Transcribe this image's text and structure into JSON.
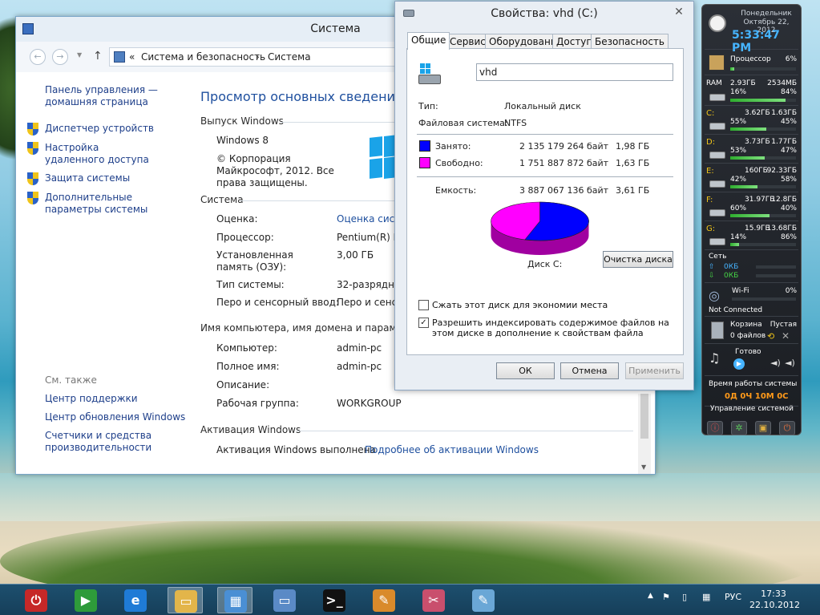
{
  "system_window": {
    "title": "Система",
    "address": {
      "prefix": "«",
      "crumbs": [
        "Система и безопасность",
        "Система"
      ],
      "separator": "›"
    },
    "nav": {
      "home_link": "Панель управления — домашняя страница",
      "items": [
        {
          "label": "Диспетчер устройств",
          "icon": "shield-icon"
        },
        {
          "label": "Настройка удаленного доступа",
          "icon": "shield-icon"
        },
        {
          "label": "Защита системы",
          "icon": "shield-icon"
        },
        {
          "label": "Дополнительные параметры системы",
          "icon": "shield-icon"
        }
      ],
      "see_also_title": "См. также",
      "see_also": [
        "Центр поддержки",
        "Центр обновления Windows",
        "Счетчики и средства производительности"
      ]
    },
    "heading": "Просмотр основных сведений о вашем компьютере",
    "edition": {
      "title": "Выпуск Windows",
      "name": "Windows 8",
      "copyright": "© Корпорация Майкрософт, 2012. Все права защищены."
    },
    "system": {
      "title": "Система",
      "rows": [
        {
          "label": "Оценка:",
          "value": "Оценка системы недоступна",
          "link": true
        },
        {
          "label": "Процессор:",
          "value": "Pentium(R) Dual-Core CPU"
        },
        {
          "label": "Установленная память (ОЗУ):",
          "value": "3,00 ГБ"
        },
        {
          "label": "Тип системы:",
          "value": "32-разрядная операционная система"
        },
        {
          "label": "Перо и сенсорный ввод:",
          "value": "Перо и сенсорный ввод недоступны"
        }
      ]
    },
    "computer": {
      "title": "Имя компьютера, имя домена и параметры рабочей группы",
      "rows": [
        {
          "label": "Компьютер:",
          "value": "admin-pc"
        },
        {
          "label": "Полное имя:",
          "value": "admin-pc"
        },
        {
          "label": "Описание:",
          "value": ""
        },
        {
          "label": "Рабочая группа:",
          "value": "WORKGROUP"
        }
      ]
    },
    "activation": {
      "title": "Активация Windows",
      "status": "Активация Windows выполнена",
      "link": "Подробнее об активации Windows"
    }
  },
  "properties_dialog": {
    "title": "Свойства: vhd (C:)",
    "close": "✕",
    "tabs": [
      "Общие",
      "Сервис",
      "Оборудование",
      "Доступ",
      "Безопасность"
    ],
    "active_tab": "Общие",
    "volume_name": "vhd",
    "type_label": "Тип:",
    "type_value": "Локальный диск",
    "fs_label": "Файловая система:",
    "fs_value": "NTFS",
    "used": {
      "label": "Занято:",
      "bytes": "2 135 179 264 байт",
      "size": "1,98 ГБ",
      "color": "#0000ff"
    },
    "free": {
      "label": "Свободно:",
      "bytes": "1 751 887 872 байт",
      "size": "1,63 ГБ",
      "color": "#ff00ff"
    },
    "capacity": {
      "label": "Емкость:",
      "bytes": "3 887 067 136 байт",
      "size": "3,61 ГБ"
    },
    "disk_label": "Диск C:",
    "cleanup_button": "Очистка диска",
    "compress_label": "Сжать этот диск для экономии места",
    "compress_checked": false,
    "index_label": "Разрешить индексировать содержимое файлов на этом диске в дополнение к свойствам файла",
    "index_checked": true,
    "ok": "ОК",
    "cancel": "Отмена",
    "apply": "Применить"
  },
  "gadget": {
    "day": "Понедельник",
    "date": "Октябрь 22, 2012",
    "time": "5:33:47 PM",
    "cpu": {
      "label": "Процессор",
      "percent": "6%",
      "level": 6
    },
    "ram": {
      "label": "RAM",
      "used": "2.93ГБ",
      "total": "2534МБ",
      "left_pct": "16%",
      "right_pct": "84%",
      "level": 84
    },
    "drives": [
      {
        "letter": "C:",
        "a": "3.62ГБ",
        "b": "1.63ГБ",
        "p1": "55%",
        "p2": "45%",
        "level": 55
      },
      {
        "letter": "D:",
        "a": "3.73ГБ",
        "b": "1.77ГБ",
        "p1": "53%",
        "p2": "47%",
        "level": 53
      },
      {
        "letter": "E:",
        "a": "160ГБ",
        "b": "92.33ГБ",
        "p1": "42%",
        "p2": "58%",
        "level": 42
      },
      {
        "letter": "F:",
        "a": "31.97ГБ",
        "b": "12.8ГБ",
        "p1": "60%",
        "p2": "40%",
        "level": 60
      },
      {
        "letter": "G:",
        "a": "15.9ГБ",
        "b": "13.68ГБ",
        "p1": "14%",
        "p2": "86%",
        "level": 14
      }
    ],
    "net": {
      "label": "Сеть",
      "up": "0КБ",
      "down": "0КБ"
    },
    "wifi": {
      "label": "Wi-Fi",
      "percent": "0%",
      "status": "Not Connected"
    },
    "recycle": {
      "label": "Корзина",
      "files": "0 файлов",
      "state": "Пустая"
    },
    "media": {
      "status": "Готово"
    },
    "uptime": {
      "label": "Время работы системы",
      "value": "0Д 0Ч 10М 0С"
    },
    "control": {
      "label": "Управление системой"
    }
  },
  "taskbar": {
    "apps": [
      {
        "name": "power",
        "glyph": "⏻",
        "color": "#c62828"
      },
      {
        "name": "media-player",
        "glyph": "▶",
        "color": "#2e9b3a"
      },
      {
        "name": "internet-explorer",
        "glyph": "e",
        "color": "#1f7bd6"
      },
      {
        "name": "file-explorer",
        "glyph": "▭",
        "color": "#e3b54a"
      },
      {
        "name": "control-panel",
        "glyph": "▦",
        "color": "#4a8fd4"
      },
      {
        "name": "window-app",
        "glyph": "▭",
        "color": "#5a8ac6"
      },
      {
        "name": "command-prompt",
        "glyph": ">_",
        "color": "#111111"
      },
      {
        "name": "paint",
        "glyph": "✎",
        "color": "#d98a2b"
      },
      {
        "name": "snipping-tool",
        "glyph": "✂",
        "color": "#c94f6d"
      },
      {
        "name": "notepad",
        "glyph": "✎",
        "color": "#6aa7d6"
      }
    ],
    "lang": "РУС",
    "time": "17:33",
    "date": "22.10.2012"
  }
}
